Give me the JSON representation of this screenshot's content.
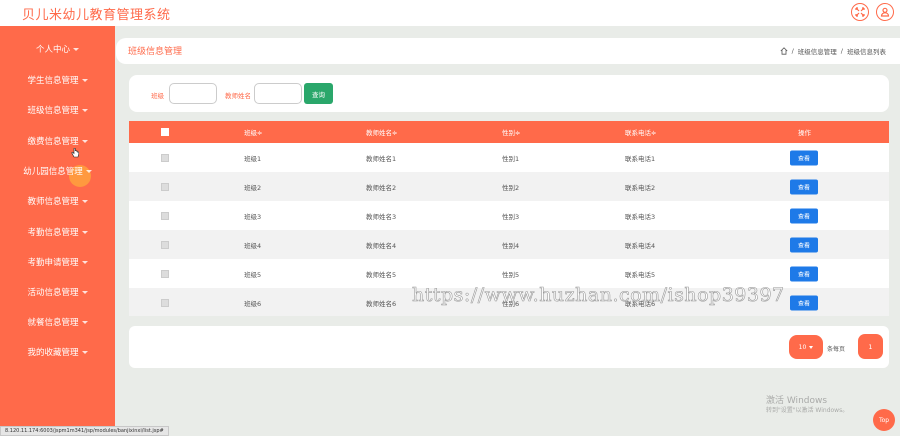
{
  "app": {
    "title": "贝儿米幼儿教育管理系统"
  },
  "top_icons": [
    "expand-icon",
    "user-icon"
  ],
  "sidebar": {
    "items": [
      {
        "label": "个人中心"
      },
      {
        "label": "学生信息管理"
      },
      {
        "label": "班级信息管理"
      },
      {
        "label": "缴费信息管理"
      },
      {
        "label": "幼儿园信息管理"
      },
      {
        "label": "教师信息管理"
      },
      {
        "label": "考勤信息管理"
      },
      {
        "label": "考勤申请管理"
      },
      {
        "label": "活动信息管理"
      },
      {
        "label": "就餐信息管理"
      },
      {
        "label": "我的收藏管理"
      }
    ]
  },
  "page": {
    "title": "班级信息管理",
    "breadcrumbs": [
      "班级信息管理",
      "班级信息列表"
    ],
    "breadcrumb_separator": "/"
  },
  "search": {
    "class_label": "班级",
    "class_value": "",
    "teacher_label": "教师姓名",
    "teacher_value": "",
    "button_label": "查询"
  },
  "table": {
    "headers": [
      "班级≑",
      "教师姓名≑",
      "性别≑",
      "联系电话≑",
      "操作"
    ],
    "rows": [
      {
        "class": "班级1",
        "teacher": "教师姓名1",
        "gender": "性别1",
        "phone": "联系电话1",
        "action": "查看"
      },
      {
        "class": "班级2",
        "teacher": "教师姓名2",
        "gender": "性别2",
        "phone": "联系电话2",
        "action": "查看"
      },
      {
        "class": "班级3",
        "teacher": "教师姓名3",
        "gender": "性别3",
        "phone": "联系电话3",
        "action": "查看"
      },
      {
        "class": "班级4",
        "teacher": "教师姓名4",
        "gender": "性别4",
        "phone": "联系电话4",
        "action": "查看"
      },
      {
        "class": "班级5",
        "teacher": "教师姓名5",
        "gender": "性别5",
        "phone": "联系电话5",
        "action": "查看"
      },
      {
        "class": "班级6",
        "teacher": "教师姓名6",
        "gender": "性别6",
        "phone": "联系电话6",
        "action": "查看"
      }
    ]
  },
  "watermark": "https://www.huzhan.com/ishop39397",
  "pagination": {
    "page_size": "10",
    "per_page_label": "条每页",
    "current_page": "1"
  },
  "windows_activation": {
    "title": "激活 Windows",
    "subtitle": "转到\"设置\"以激活 Windows。"
  },
  "top_button": "Top",
  "status_url": "8.120.11.174:6003/jspm1m341/jsp/modules/banjixinxi/list.jsp#",
  "colors": {
    "accent": "#ff6a4a",
    "search_button": "#2aa76b",
    "view_button": "#1e7ae8"
  }
}
